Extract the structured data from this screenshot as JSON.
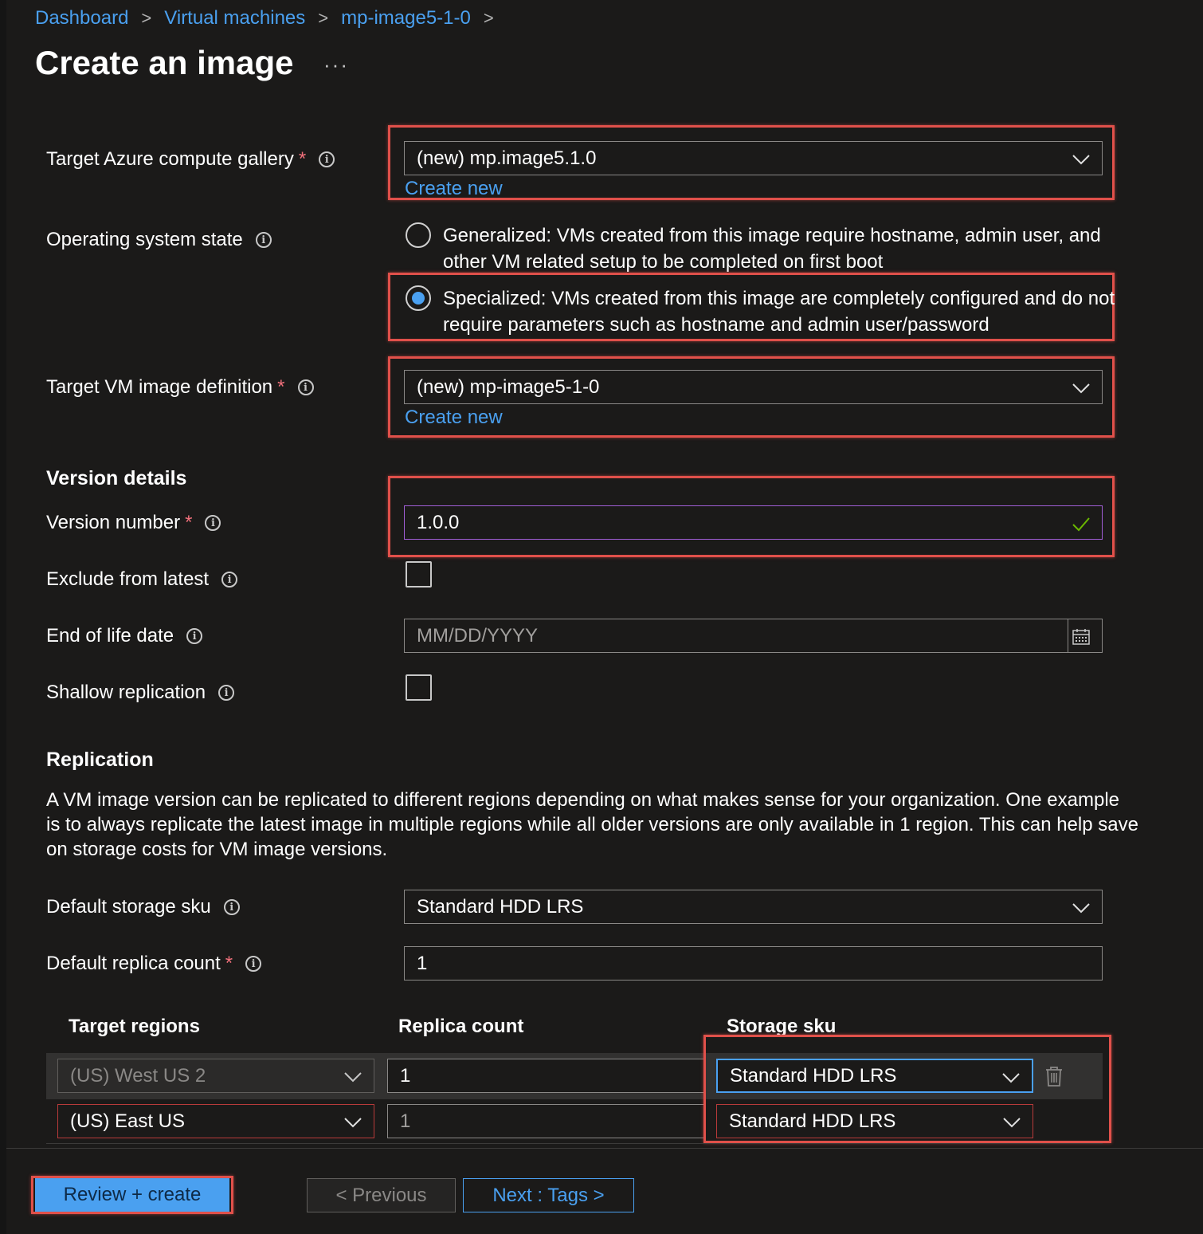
{
  "breadcrumb": {
    "items": [
      "Dashboard",
      "Virtual machines",
      "mp-image5-1-0"
    ],
    "separator": ">"
  },
  "page": {
    "title": "Create an image",
    "more": "···"
  },
  "form": {
    "gallery": {
      "label": "Target Azure compute gallery",
      "required": "*",
      "value": "(new) mp.image5.1.0",
      "create_new": "Create new"
    },
    "os_state": {
      "label": "Operating system state",
      "options": [
        {
          "text_line1": "Generalized: VMs created from this image require hostname, admin user, and",
          "text_line2": "other VM related setup to be completed on first boot",
          "selected": false
        },
        {
          "text_line1": "Specialized: VMs created from this image are completely configured and do not",
          "text_line2": "require parameters such as hostname and admin user/password",
          "selected": true
        }
      ]
    },
    "image_definition": {
      "label": "Target VM image definition",
      "required": "*",
      "value": "(new) mp-image5-1-0",
      "create_new": "Create new"
    },
    "version_details": {
      "heading": "Version details",
      "version_number": {
        "label": "Version number",
        "required": "*",
        "value": "1.0.0"
      },
      "exclude_from_latest": {
        "label": "Exclude from latest",
        "checked": false
      },
      "end_of_life": {
        "label": "End of life date",
        "placeholder": "MM/DD/YYYY"
      },
      "shallow_replication": {
        "label": "Shallow replication",
        "checked": false
      }
    },
    "replication": {
      "heading": "Replication",
      "description_lines": [
        "A VM image version can be replicated to different regions depending on what makes sense for your organization. One example",
        "is to always replicate the latest image in multiple regions while all older versions are only available in 1 region. This can help save",
        "on storage costs for VM image versions."
      ],
      "default_storage_sku": {
        "label": "Default storage sku",
        "value": "Standard HDD LRS"
      },
      "default_replica_count": {
        "label": "Default replica count",
        "required": "*",
        "value": "1"
      }
    },
    "regions_table": {
      "headers": [
        "Target regions",
        "Replica count",
        "Storage sku"
      ],
      "rows": [
        {
          "region": "(US) West US 2",
          "replicas": "1",
          "sku": "Standard HDD LRS"
        },
        {
          "region": "(US) East US",
          "replicas": "1",
          "sku": "Standard HDD LRS"
        }
      ]
    }
  },
  "footer": {
    "review_create": "Review + create",
    "previous": "< Previous",
    "next": "Next : Tags >"
  },
  "colors": {
    "background": "#1b1a19",
    "link": "#4aa0f0",
    "required": "#f1707b",
    "highlight": "#e0504a",
    "valid_check": "#6bb700",
    "focus_purple": "#a15ed6"
  }
}
